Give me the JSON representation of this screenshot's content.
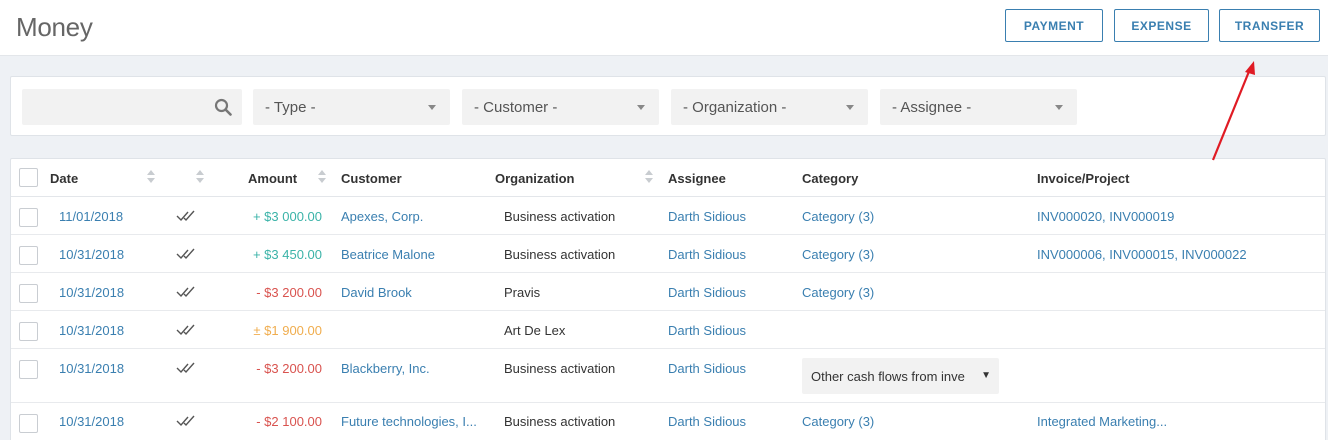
{
  "header": {
    "title": "Money",
    "buttons": {
      "payment": "PAYMENT",
      "expense": "EXPENSE",
      "transfer": "TRANSFER"
    }
  },
  "filters": {
    "search": {
      "value": "",
      "placeholder": ""
    },
    "type": "- Type -",
    "customer": "- Customer -",
    "organization": "- Organization -",
    "assignee": "- Assignee -"
  },
  "table": {
    "columns": {
      "date": "Date",
      "amount": "Amount",
      "customer": "Customer",
      "organization": "Organization",
      "assignee": "Assignee",
      "category": "Category",
      "invoice": "Invoice/Project"
    },
    "rows": [
      {
        "date": "11/01/2018",
        "amount": "+ $3 000.00",
        "customer": "Apexes, Corp.",
        "organization": "Business activation",
        "assignee": "Darth Sidious",
        "category": "Category (3)",
        "invoice": "INV000020, INV000019"
      },
      {
        "date": "10/31/2018",
        "amount": "+ $3 450.00",
        "customer": "Beatrice Malone",
        "organization": "Business activation",
        "assignee": "Darth Sidious",
        "category": "Category (3)",
        "invoice": "INV000006, INV000015, INV000022"
      },
      {
        "date": "10/31/2018",
        "amount": "- $3 200.00",
        "customer": "David Brook",
        "organization": "Pravis",
        "assignee": "Darth Sidious",
        "category": "Category (3)",
        "invoice": ""
      },
      {
        "date": "10/31/2018",
        "amount": "± $1 900.00",
        "customer": "",
        "organization": "Art De Lex",
        "assignee": "Darth Sidious",
        "category": "",
        "invoice": ""
      },
      {
        "date": "10/31/2018",
        "amount": "- $3 200.00",
        "customer": "Blackberry, Inc.",
        "organization": "Business activation",
        "assignee": "Darth Sidious",
        "category_select": "Other cash flows from inve",
        "invoice": ""
      },
      {
        "date": "10/31/2018",
        "amount": "- $2 100.00",
        "customer": "Future technologies, I...",
        "organization": "Business activation",
        "assignee": "Darth Sidious",
        "category": "Category (3)",
        "invoice": "Integrated Marketing..."
      }
    ]
  },
  "colors": {
    "accent": "#3a7fb0",
    "positive": "#3bb3a8",
    "negative": "#d9534f",
    "transfer": "#f0ad4e",
    "annotation": "#e01b24"
  },
  "icons": {
    "search": "search-icon",
    "cleared": "double-check-icon",
    "sort": "sort-icon"
  }
}
